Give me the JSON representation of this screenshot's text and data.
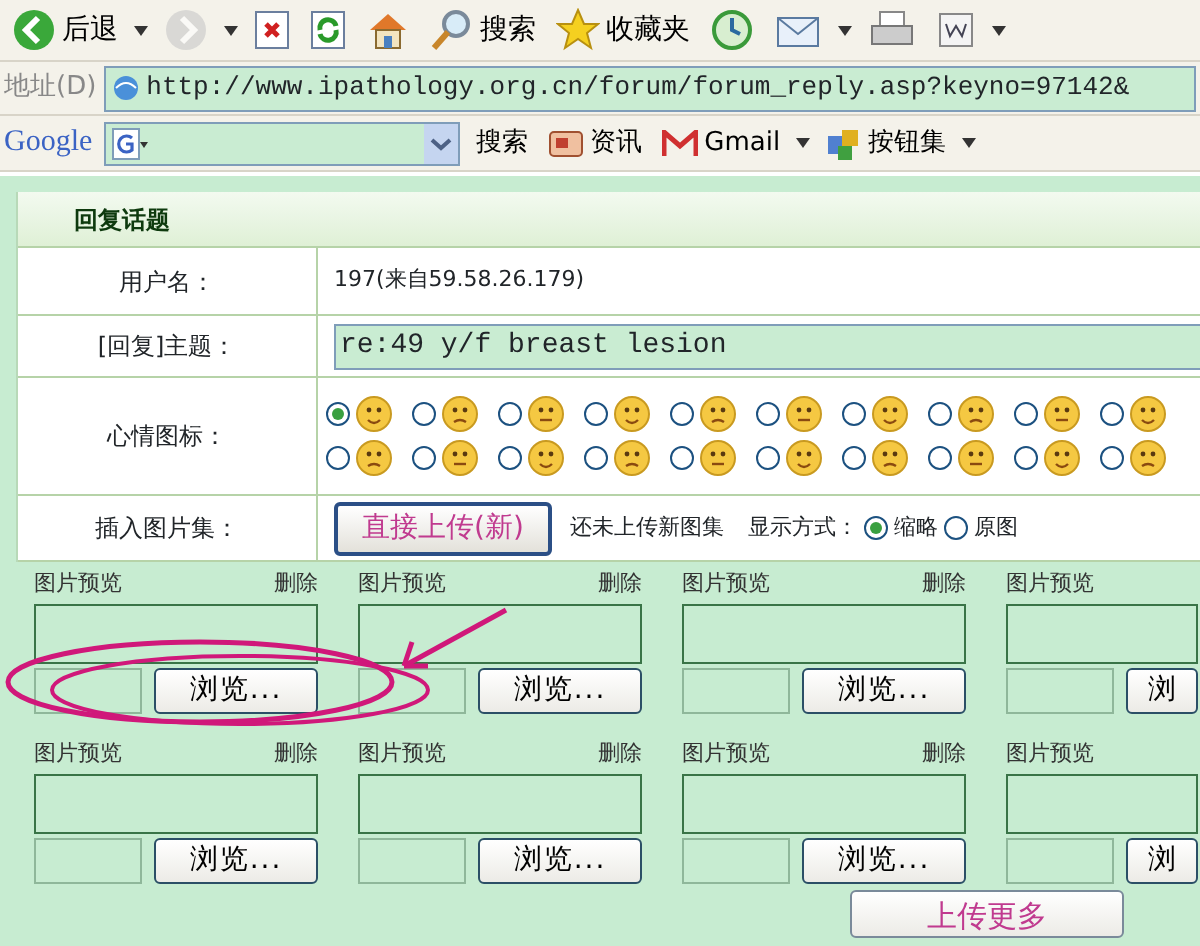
{
  "toolbar": [
    {
      "kind": "back",
      "label": "后退",
      "dropdown": true,
      "disabled": false
    },
    {
      "kind": "forward",
      "dropdown": true,
      "disabled": true
    },
    {
      "kind": "stop",
      "disabled": false
    },
    {
      "kind": "refresh",
      "disabled": false
    },
    {
      "kind": "home",
      "disabled": false
    },
    {
      "kind": "search",
      "label": "搜索",
      "disabled": false
    },
    {
      "kind": "favorites",
      "label": "收藏夹",
      "disabled": false
    },
    {
      "kind": "history",
      "disabled": false
    },
    {
      "kind": "mail",
      "dropdown": true,
      "disabled": false
    },
    {
      "kind": "print",
      "disabled": false
    },
    {
      "kind": "word",
      "dropdown": true,
      "disabled": false
    }
  ],
  "address_bar": {
    "label": "地址(D)",
    "url": "http://www.ipathology.org.cn/forum/forum_reply.asp?keyno=97142&"
  },
  "google_bar": {
    "logo": "Google",
    "search_label": "搜索",
    "buttons": [
      {
        "kind": "news",
        "label": "资讯",
        "dropdown": false
      },
      {
        "kind": "gmail",
        "label": "Gmail",
        "dropdown": true
      },
      {
        "kind": "buttons",
        "label": "按钮集",
        "dropdown": true
      }
    ]
  },
  "form": {
    "title": "回复话题",
    "username": {
      "label": "用户名：",
      "value": "197(来自59.58.26.179)"
    },
    "subject": {
      "label": "[回复]主题：",
      "value": "re:49 y/f breast lesion"
    },
    "mood": {
      "label": "心情图标：",
      "options": [
        {
          "selected": true
        },
        {
          "selected": false
        },
        {
          "selected": false
        },
        {
          "selected": false
        },
        {
          "selected": false
        },
        {
          "selected": false
        },
        {
          "selected": false
        },
        {
          "selected": false
        },
        {
          "selected": false
        },
        {
          "selected": false
        },
        {
          "selected": false
        },
        {
          "selected": false
        },
        {
          "selected": false
        },
        {
          "selected": false
        },
        {
          "selected": false
        },
        {
          "selected": false
        },
        {
          "selected": false
        },
        {
          "selected": false
        },
        {
          "selected": false
        },
        {
          "selected": false
        }
      ]
    },
    "album": {
      "label": "插入图片集：",
      "upload_button": "直接上传(新)",
      "status": "还未上传新图集",
      "display_label": "显示方式：",
      "display_options": [
        {
          "label": "缩略",
          "selected": true
        },
        {
          "label": "原图",
          "selected": false
        }
      ]
    }
  },
  "upload_slots": [
    {
      "preview_label": "图片预览",
      "delete": "删除",
      "browse": "浏览..."
    },
    {
      "preview_label": "图片预览",
      "delete": "删除",
      "browse": "浏览..."
    },
    {
      "preview_label": "图片预览",
      "delete": "删除",
      "browse": "浏览..."
    },
    {
      "preview_label": "图片预览",
      "browse": "浏"
    },
    {
      "preview_label": "图片预览",
      "delete": "删除",
      "browse": "浏览..."
    },
    {
      "preview_label": "图片预览",
      "delete": "删除",
      "browse": "浏览..."
    },
    {
      "preview_label": "图片预览",
      "delete": "删除",
      "browse": "浏览..."
    },
    {
      "preview_label": "图片预览",
      "browse": "浏"
    }
  ],
  "more_button": "上传更多"
}
